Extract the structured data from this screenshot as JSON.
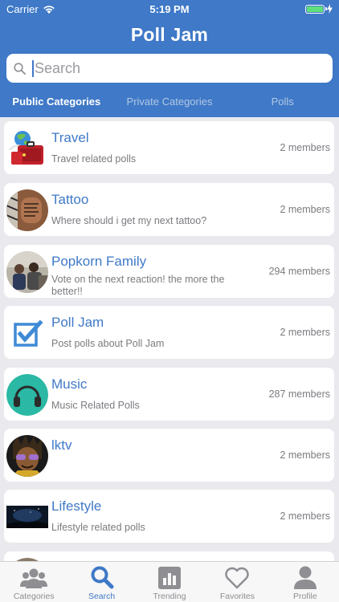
{
  "status_bar": {
    "carrier": "Carrier",
    "time": "5:19 PM"
  },
  "app_title": "Poll Jam",
  "search": {
    "placeholder": "Search",
    "value": ""
  },
  "tabs": [
    {
      "label": "Public Categories",
      "active": true
    },
    {
      "label": "Private Categories",
      "active": false
    },
    {
      "label": "Polls",
      "active": false
    }
  ],
  "categories": [
    {
      "name": "Travel",
      "description": "Travel related polls",
      "members": "2 members",
      "icon": "travel-suitcase-globe"
    },
    {
      "name": "Tattoo",
      "description": "Where should i get my next tattoo?",
      "members": "2 members",
      "icon": "tattoo-photo"
    },
    {
      "name": "Popkorn Family",
      "description": "Vote on the next reaction! the more the better!!",
      "members": "294 members",
      "icon": "family-photo"
    },
    {
      "name": "Poll Jam",
      "description": "Post polls about Poll Jam",
      "members": "2 members",
      "icon": "checkbox-check"
    },
    {
      "name": "Music",
      "description": "Music Related Polls",
      "members": "287 members",
      "icon": "headphones"
    },
    {
      "name": "lktv",
      "description": "",
      "members": "2 members",
      "icon": "cartoon-avatar"
    },
    {
      "name": "Lifestyle",
      "description": "Lifestyle related polls",
      "members": "2 members",
      "icon": "night-landscape"
    },
    {
      "name": "",
      "description": "",
      "members": "",
      "icon": "partial-avatar"
    }
  ],
  "tab_bar": [
    {
      "label": "Categories",
      "icon": "people-icon",
      "active": false
    },
    {
      "label": "Search",
      "icon": "search-icon",
      "active": true
    },
    {
      "label": "Trending",
      "icon": "bar-chart-icon",
      "active": false
    },
    {
      "label": "Favorites",
      "icon": "heart-icon",
      "active": false
    },
    {
      "label": "Profile",
      "icon": "person-icon",
      "active": false
    }
  ],
  "colors": {
    "brand": "#3f79c7",
    "accent_green": "#5fe07a"
  }
}
